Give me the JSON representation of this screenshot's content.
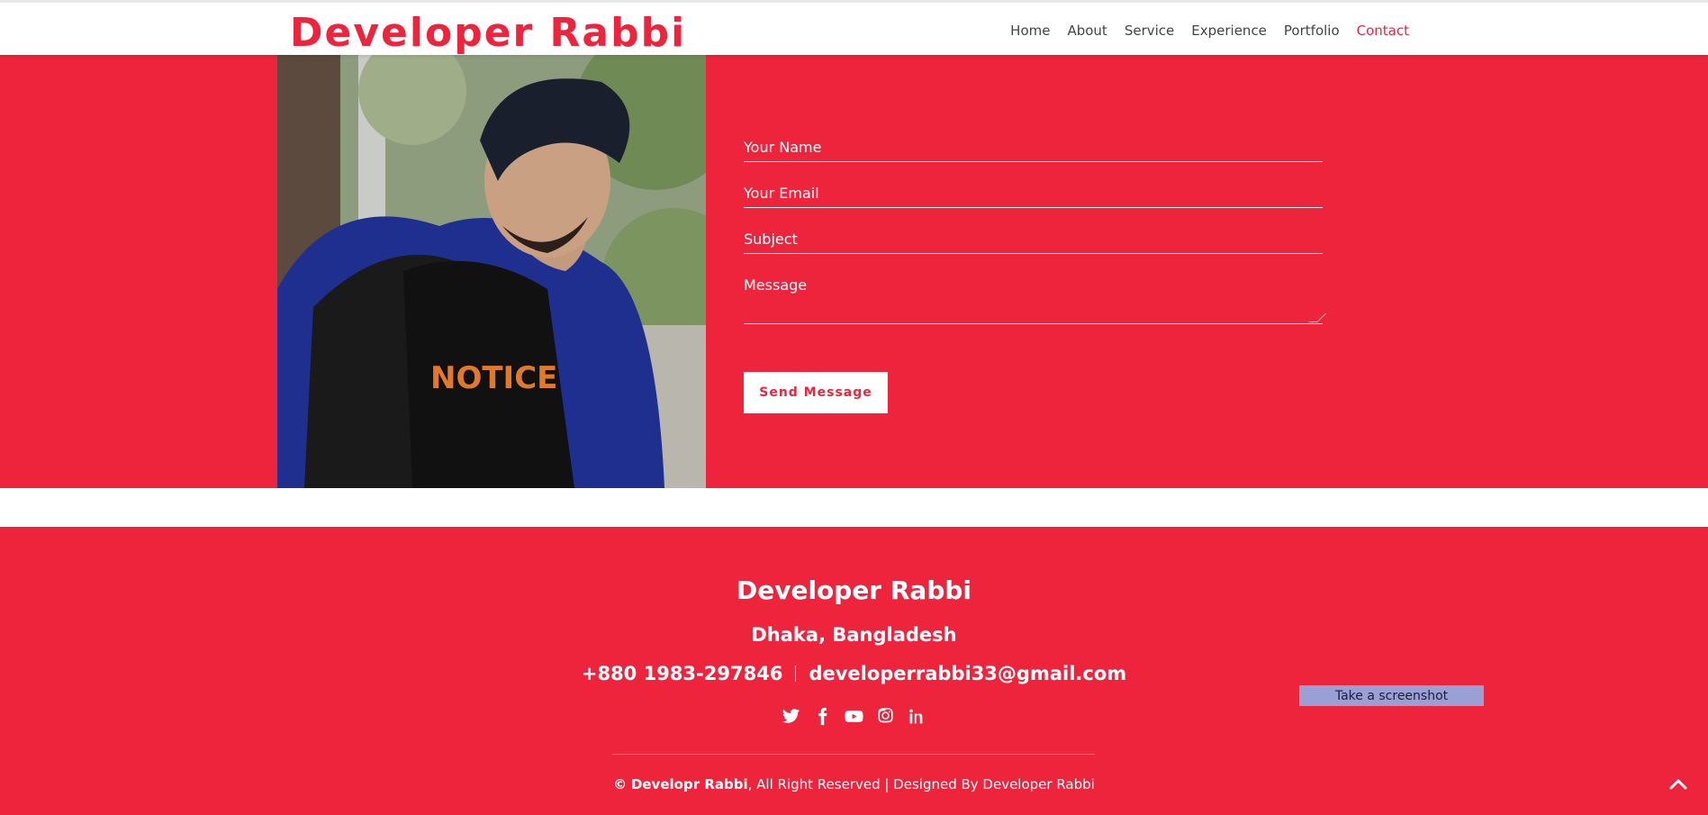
{
  "header": {
    "brand": "Developer Rabbi",
    "nav": [
      {
        "label": "Home"
      },
      {
        "label": "About"
      },
      {
        "label": "Service"
      },
      {
        "label": "Experience"
      },
      {
        "label": "Portfolio"
      },
      {
        "label": "Contact"
      }
    ],
    "active_nav": "Contact"
  },
  "contact_form": {
    "name_placeholder": "Your Name",
    "email_placeholder": "Your Email",
    "subject_placeholder": "Subject",
    "message_placeholder": "Message",
    "submit_label": "Send Message"
  },
  "footer": {
    "title": "Developer Rabbi",
    "location": "Dhaka, Bangladesh",
    "phone": "+880 1983-297846",
    "email": "developerrabbi33@gmail.com",
    "socials": [
      "twitter-icon",
      "facebook-icon",
      "youtube-icon",
      "instagram-icon",
      "linkedin-icon"
    ],
    "copyright_symbol": "©",
    "copyright_name": "Developr Rabbi",
    "copyright_rest": ", All Right Reserved | Designed By Developer Rabbi"
  },
  "overlay": {
    "screenshot_label": "Take a screenshot"
  },
  "colors": {
    "accent": "#ee233c",
    "white": "#ffffff"
  }
}
